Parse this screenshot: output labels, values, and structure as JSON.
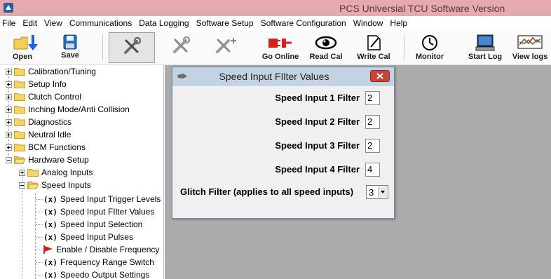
{
  "window": {
    "title": "PCS Universial TCU Software Version"
  },
  "menu": [
    "File",
    "Edit",
    "View",
    "Communications",
    "Data Logging",
    "Software Setup",
    "Software Configuration",
    "Window",
    "Help"
  ],
  "toolbar": {
    "open": "Open",
    "save": "Save",
    "go_online": "Go Online",
    "read_cal": "Read Cal",
    "write_cal": "Write Cal",
    "monitor": "Monitor",
    "start_log": "Start Log",
    "view_logs": "View logs"
  },
  "tree": {
    "items": [
      "Calibration/Tuning",
      "Setup Info",
      "Clutch Control",
      "Inching Mode/Anti Collision",
      "Diagnostics",
      "Neutral Idle",
      "BCM Functions",
      "Hardware Setup",
      "Analog Inputs",
      "Speed Inputs",
      "Speed Input Trigger Levels",
      "Speed Input FIlter Values",
      "Speed Input Selection",
      "Speed Input Pulses",
      "Enable / Disable Frequency",
      "Frequency Range Switch",
      "Speedo Output Settings"
    ],
    "x_marker": "(x)"
  },
  "dialog": {
    "title": "Speed Input FIlter Values",
    "fields": [
      {
        "label": "Speed Input 1 Filter",
        "value": "2"
      },
      {
        "label": "Speed Input 2 Filter",
        "value": "2"
      },
      {
        "label": "Speed Input 3 Filter",
        "value": "2"
      },
      {
        "label": "Speed Input 4 Filter",
        "value": "4"
      }
    ],
    "glitch_label": "Glitch Filter (applies to all speed inputs)",
    "glitch_value": "3"
  }
}
